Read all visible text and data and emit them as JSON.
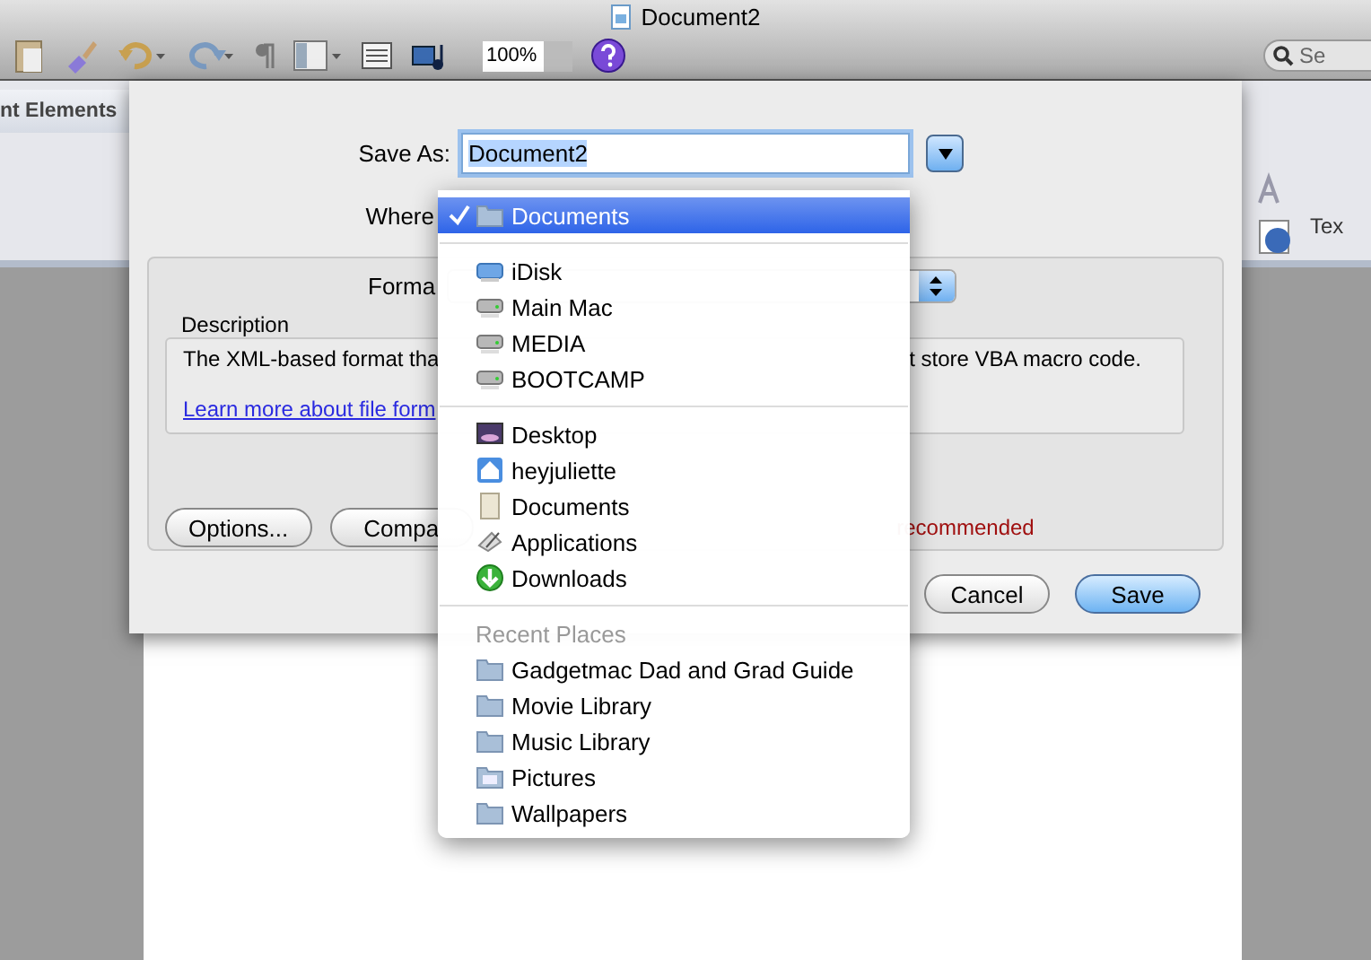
{
  "window": {
    "title": "Document2"
  },
  "toolbar": {
    "zoom": "100%",
    "search_placeholder": "Se"
  },
  "ribbon": {
    "tab_label": "nt Elements",
    "right_label": "Tex"
  },
  "dialog": {
    "save_as_label": "Save As:",
    "file_name": "Document2",
    "where_label": "Where",
    "format_label": "Forma",
    "description_label": "Description",
    "description_parts": [
      "The XML-based format tha",
      "t store VBA macro code."
    ],
    "link": "Learn more about file form",
    "buttons": [
      "Options...",
      "Compa"
    ],
    "warning": "recommended",
    "actions": [
      {
        "label": "Cancel",
        "default": false
      },
      {
        "label": "Save",
        "default": true
      }
    ]
  },
  "menu": {
    "sections": [
      {
        "items": [
          {
            "label": "Documents",
            "kind": "folder",
            "selected": true
          }
        ]
      },
      {
        "items": [
          {
            "label": "iDisk",
            "kind": "idisk",
            "selected": false
          },
          {
            "label": "Main Mac",
            "kind": "drive",
            "selected": false
          },
          {
            "label": "MEDIA",
            "kind": "drive",
            "selected": false
          },
          {
            "label": "BOOTCAMP",
            "kind": "drive",
            "selected": false
          }
        ]
      },
      {
        "items": [
          {
            "label": "Desktop",
            "kind": "desktop",
            "selected": false
          },
          {
            "label": "heyjuliette",
            "kind": "home",
            "selected": false
          },
          {
            "label": "Documents",
            "kind": "document",
            "selected": false
          },
          {
            "label": "Applications",
            "kind": "apps",
            "selected": false
          },
          {
            "label": "Downloads",
            "kind": "download",
            "selected": false
          }
        ]
      },
      {
        "heading": "Recent Places",
        "items": [
          {
            "label": "Gadgetmac Dad and Grad Guide",
            "kind": "folder",
            "selected": false
          },
          {
            "label": "Movie Library",
            "kind": "folder",
            "selected": false
          },
          {
            "label": "Music Library",
            "kind": "folder",
            "selected": false
          },
          {
            "label": "Pictures",
            "kind": "pictures",
            "selected": false
          },
          {
            "label": "Wallpapers",
            "kind": "folder",
            "selected": false
          }
        ]
      }
    ]
  }
}
